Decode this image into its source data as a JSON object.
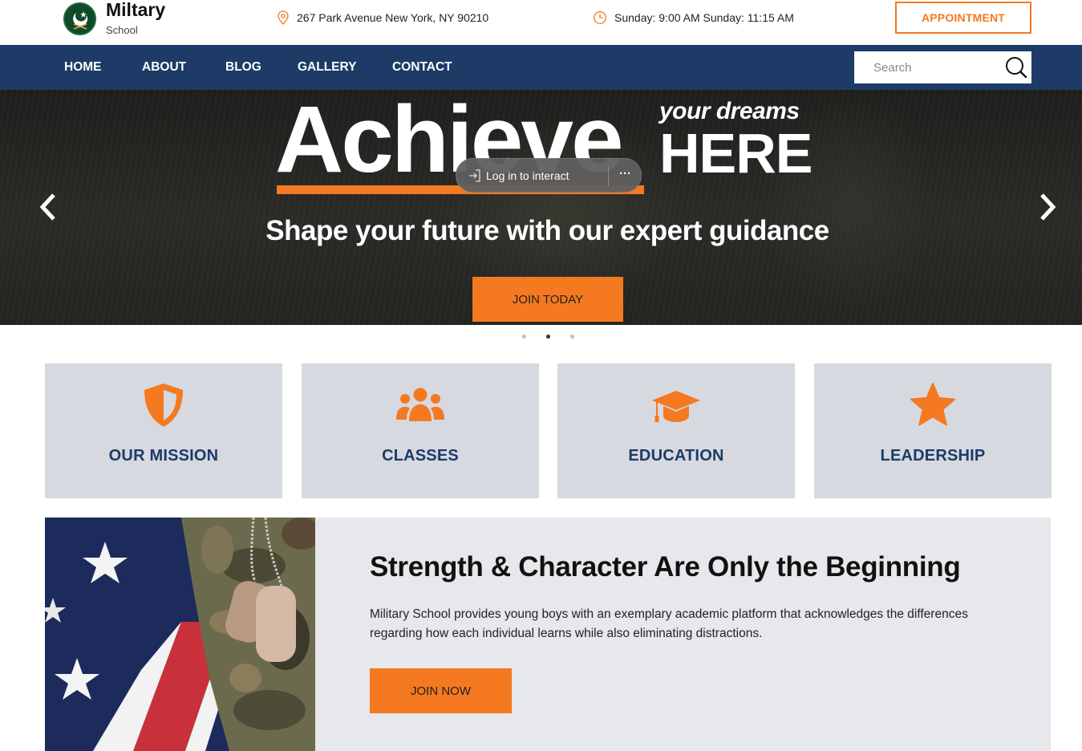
{
  "brand": {
    "title": "Miltary",
    "subtitle": "School"
  },
  "header": {
    "address": "267 Park Avenue New York, NY 90210",
    "hours": "Sunday: 9:00 AM Sunday: 11:15 AM",
    "appointment_label": "APPOINTMENT",
    "accent_color": "#f47920"
  },
  "nav": {
    "items": [
      {
        "label": "HOME"
      },
      {
        "label": "ABOUT"
      },
      {
        "label": "BLOG"
      },
      {
        "label": "GALLERY"
      },
      {
        "label": "CONTACT"
      }
    ],
    "search_placeholder": "Search",
    "background_color": "#1d3b66"
  },
  "hero": {
    "headline": "Achieve",
    "tagline": "your dreams",
    "headline_2": "HERE",
    "subtitle": "Shape your future with our expert guidance",
    "cta_label": "JOIN TODAY",
    "slide_count": 3,
    "active_slide": 2
  },
  "overlay": {
    "login_label": "Log in to interact",
    "more_label": "···"
  },
  "features": [
    {
      "label": "OUR MISSION",
      "icon": "shield-icon"
    },
    {
      "label": "CLASSES",
      "icon": "users-icon"
    },
    {
      "label": "EDUCATION",
      "icon": "graduation-cap-icon"
    },
    {
      "label": "LEADERSHIP",
      "icon": "star-icon"
    }
  ],
  "about": {
    "title": "Strength & Character Are Only the Beginning",
    "text": "Military School provides young boys with an exemplary academic platform that acknowledges the differences regarding how each individual learns while also eliminating distractions.",
    "cta_label": "JOIN NOW"
  }
}
